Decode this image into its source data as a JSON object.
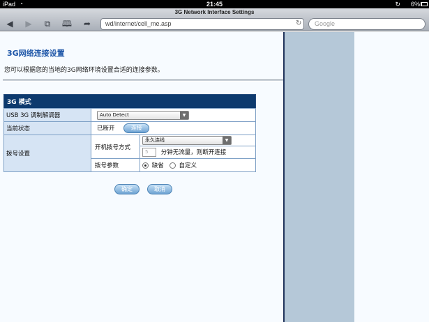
{
  "status_bar": {
    "device": "iPad",
    "wifi_icon": "wifi-icon",
    "time": "21:45",
    "battery": "6%"
  },
  "browser": {
    "page_title": "3G Network Interface Settings",
    "url": "wd/internet/cell_me.asp",
    "search_placeholder": "Google",
    "icons": {
      "back": "back-arrow-icon",
      "forward": "forward-arrow-icon",
      "pages": "pages-icon",
      "bookmarks": "bookmarks-icon",
      "share": "share-icon",
      "reload": "reload-icon"
    }
  },
  "page": {
    "title": "3G网络连接设置",
    "description": "您可以根据您的当地的3G网络环境设置合适的连接参数。",
    "table": {
      "header": "3G 模式",
      "rows": {
        "modem_label": "USB 3G 调制解调器",
        "modem_value": "Auto Detect",
        "status_label": "当前状态",
        "status_value": "已断开",
        "connect_button": "连接",
        "dial_label": "拨号设置",
        "dial_mode_label": "开机拨号方式",
        "dial_mode_value": "永久连线",
        "idle_value": "5",
        "idle_text": "分钟无流量，则断开连接",
        "dial_params_label": "拨号参数",
        "option_default": "缺省",
        "option_custom": "自定义"
      }
    },
    "buttons": {
      "ok": "确定",
      "cancel": "取消"
    }
  },
  "colors": {
    "header_bg": "#0d3a6e",
    "title_blue": "#1e56a8",
    "side_panel": "#b5c8d8",
    "label_bg": "#d6e4f4"
  }
}
